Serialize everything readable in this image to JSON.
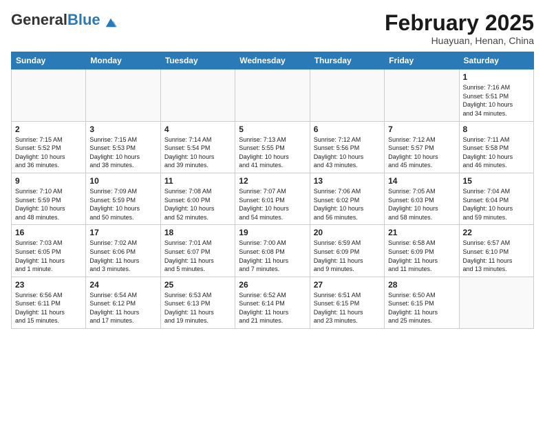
{
  "header": {
    "logo_general": "General",
    "logo_blue": "Blue",
    "month_title": "February 2025",
    "location": "Huayuan, Henan, China"
  },
  "days_of_week": [
    "Sunday",
    "Monday",
    "Tuesday",
    "Wednesday",
    "Thursday",
    "Friday",
    "Saturday"
  ],
  "weeks": [
    [
      {
        "day": "",
        "info": ""
      },
      {
        "day": "",
        "info": ""
      },
      {
        "day": "",
        "info": ""
      },
      {
        "day": "",
        "info": ""
      },
      {
        "day": "",
        "info": ""
      },
      {
        "day": "",
        "info": ""
      },
      {
        "day": "1",
        "info": "Sunrise: 7:16 AM\nSunset: 5:51 PM\nDaylight: 10 hours\nand 34 minutes."
      }
    ],
    [
      {
        "day": "2",
        "info": "Sunrise: 7:15 AM\nSunset: 5:52 PM\nDaylight: 10 hours\nand 36 minutes."
      },
      {
        "day": "3",
        "info": "Sunrise: 7:15 AM\nSunset: 5:53 PM\nDaylight: 10 hours\nand 38 minutes."
      },
      {
        "day": "4",
        "info": "Sunrise: 7:14 AM\nSunset: 5:54 PM\nDaylight: 10 hours\nand 39 minutes."
      },
      {
        "day": "5",
        "info": "Sunrise: 7:13 AM\nSunset: 5:55 PM\nDaylight: 10 hours\nand 41 minutes."
      },
      {
        "day": "6",
        "info": "Sunrise: 7:12 AM\nSunset: 5:56 PM\nDaylight: 10 hours\nand 43 minutes."
      },
      {
        "day": "7",
        "info": "Sunrise: 7:12 AM\nSunset: 5:57 PM\nDaylight: 10 hours\nand 45 minutes."
      },
      {
        "day": "8",
        "info": "Sunrise: 7:11 AM\nSunset: 5:58 PM\nDaylight: 10 hours\nand 46 minutes."
      }
    ],
    [
      {
        "day": "9",
        "info": "Sunrise: 7:10 AM\nSunset: 5:59 PM\nDaylight: 10 hours\nand 48 minutes."
      },
      {
        "day": "10",
        "info": "Sunrise: 7:09 AM\nSunset: 5:59 PM\nDaylight: 10 hours\nand 50 minutes."
      },
      {
        "day": "11",
        "info": "Sunrise: 7:08 AM\nSunset: 6:00 PM\nDaylight: 10 hours\nand 52 minutes."
      },
      {
        "day": "12",
        "info": "Sunrise: 7:07 AM\nSunset: 6:01 PM\nDaylight: 10 hours\nand 54 minutes."
      },
      {
        "day": "13",
        "info": "Sunrise: 7:06 AM\nSunset: 6:02 PM\nDaylight: 10 hours\nand 56 minutes."
      },
      {
        "day": "14",
        "info": "Sunrise: 7:05 AM\nSunset: 6:03 PM\nDaylight: 10 hours\nand 58 minutes."
      },
      {
        "day": "15",
        "info": "Sunrise: 7:04 AM\nSunset: 6:04 PM\nDaylight: 10 hours\nand 59 minutes."
      }
    ],
    [
      {
        "day": "16",
        "info": "Sunrise: 7:03 AM\nSunset: 6:05 PM\nDaylight: 11 hours\nand 1 minute."
      },
      {
        "day": "17",
        "info": "Sunrise: 7:02 AM\nSunset: 6:06 PM\nDaylight: 11 hours\nand 3 minutes."
      },
      {
        "day": "18",
        "info": "Sunrise: 7:01 AM\nSunset: 6:07 PM\nDaylight: 11 hours\nand 5 minutes."
      },
      {
        "day": "19",
        "info": "Sunrise: 7:00 AM\nSunset: 6:08 PM\nDaylight: 11 hours\nand 7 minutes."
      },
      {
        "day": "20",
        "info": "Sunrise: 6:59 AM\nSunset: 6:09 PM\nDaylight: 11 hours\nand 9 minutes."
      },
      {
        "day": "21",
        "info": "Sunrise: 6:58 AM\nSunset: 6:09 PM\nDaylight: 11 hours\nand 11 minutes."
      },
      {
        "day": "22",
        "info": "Sunrise: 6:57 AM\nSunset: 6:10 PM\nDaylight: 11 hours\nand 13 minutes."
      }
    ],
    [
      {
        "day": "23",
        "info": "Sunrise: 6:56 AM\nSunset: 6:11 PM\nDaylight: 11 hours\nand 15 minutes."
      },
      {
        "day": "24",
        "info": "Sunrise: 6:54 AM\nSunset: 6:12 PM\nDaylight: 11 hours\nand 17 minutes."
      },
      {
        "day": "25",
        "info": "Sunrise: 6:53 AM\nSunset: 6:13 PM\nDaylight: 11 hours\nand 19 minutes."
      },
      {
        "day": "26",
        "info": "Sunrise: 6:52 AM\nSunset: 6:14 PM\nDaylight: 11 hours\nand 21 minutes."
      },
      {
        "day": "27",
        "info": "Sunrise: 6:51 AM\nSunset: 6:15 PM\nDaylight: 11 hours\nand 23 minutes."
      },
      {
        "day": "28",
        "info": "Sunrise: 6:50 AM\nSunset: 6:15 PM\nDaylight: 11 hours\nand 25 minutes."
      },
      {
        "day": "",
        "info": ""
      }
    ]
  ]
}
